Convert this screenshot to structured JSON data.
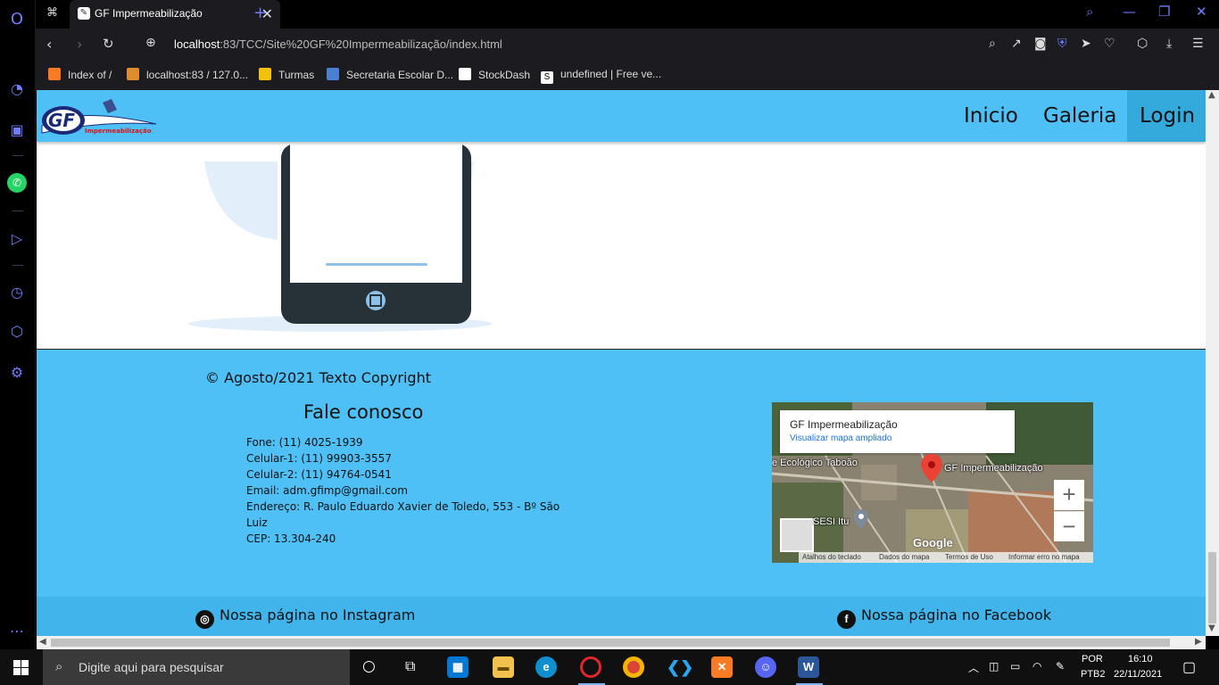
{
  "browser": {
    "tab_title": "GF Impermeabilização",
    "url_host": "localhost",
    "url_rest": ":83/TCC/Site%20GF%20Impermeabilização/index.html",
    "bookmarks": [
      "Index of /",
      "localhost:83 / 127.0...",
      "Turmas",
      "Secretaria Escolar D...",
      "StockDash",
      "undefined | Free ve..."
    ]
  },
  "site": {
    "logo_main": "GF",
    "logo_sub": "Impermeabilização",
    "nav": [
      "Inicio",
      "Galeria",
      "Login"
    ],
    "active_nav": "Login"
  },
  "footer": {
    "copyright": "© Agosto/2021 Texto Copyright",
    "contact_title": "Fale conosco",
    "contact_lines": [
      "Fone: (11) 4025-1939",
      "Celular-1: (11) 99903-3557",
      "Celular-2: (11) 94764-0541",
      "Email: adm.gfimp@gmail.com",
      "Endereço: R. Paulo Eduardo Xavier de Toledo, 553 - Bº São Luiz",
      "CEP: 13.304-240"
    ],
    "map": {
      "place_title": "GF Impermeabilização",
      "place_link": "Visualizar mapa ampliado",
      "label_park": "e Ecológico Taboão",
      "label_pin": "GF Impermeabilização",
      "label_sesi": "SESI Itu",
      "google": "Google",
      "zoom_in": "+",
      "zoom_out": "−",
      "attribution": [
        "Atalhos do teclado",
        "Dados do mapa",
        "Termos de Uso",
        "Informar erro no mapa"
      ]
    },
    "instagram_text": "Nossa página no Instagram",
    "facebook_text": "Nossa página no Facebook"
  },
  "taskbar": {
    "search_placeholder": "Digite aqui para pesquisar",
    "lang": "POR",
    "layout": "PTB2",
    "time": "16:10",
    "date": "22/11/2021"
  },
  "colors": {
    "site_blue": "#4fc0f6",
    "active_nav": "#34a9dc",
    "opera_accent": "#6f7cff"
  }
}
